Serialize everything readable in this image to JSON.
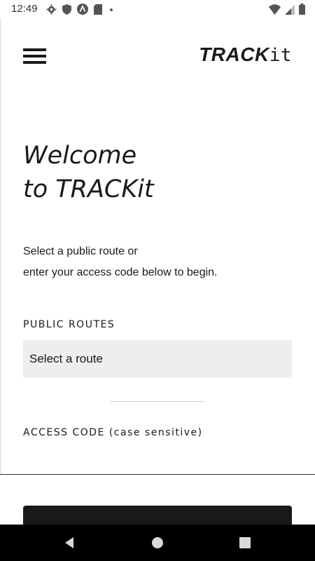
{
  "status_bar": {
    "time": "12:49",
    "left_icons": [
      "gear-icon",
      "shield-icon",
      "a-circle-icon",
      "sd-card-icon",
      "dot-icon"
    ],
    "right_icons": [
      "wifi-icon",
      "signal-icon",
      "battery-icon"
    ]
  },
  "header": {
    "menu_icon": "hamburger-icon",
    "brand_strong": "TRACK",
    "brand_light": "it"
  },
  "main": {
    "title_line1": "Welcome",
    "title_line2": "to TRACKit",
    "intro_line1": "Select a public route or",
    "intro_line2": "enter your access code below to begin.",
    "public_routes_label": "PUBLIC ROUTES",
    "route_select_value": "Select a route",
    "access_code_label": "ACCESS CODE (case sensitive)"
  },
  "nav": {
    "back": "back-icon",
    "home": "home-icon",
    "recents": "recents-icon"
  },
  "colors": {
    "text": "#1a1a1a",
    "select_bg": "#eeeeee",
    "nav_bg": "#000000",
    "button_bg": "#1a1a1a"
  }
}
